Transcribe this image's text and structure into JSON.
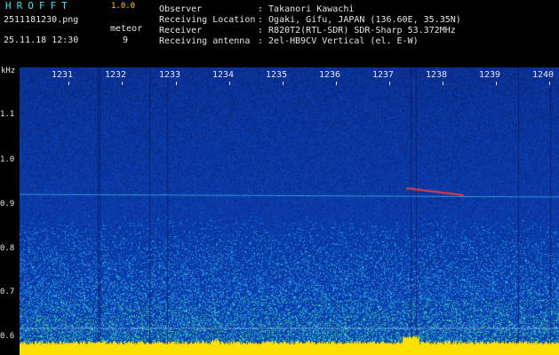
{
  "header": {
    "logo": "HROFFT",
    "version": "1.0.0",
    "filename": "2511181230.png",
    "meteor_label": "meteor",
    "meteor_count": "9",
    "datetime": "25.11.18 12:30",
    "observer_label": "Observer",
    "observer_value": ": Takanori Kawachi",
    "location_label": "Receiving Location",
    "location_value": ": Ogaki, Gifu, JAPAN (136.60E, 35.35N)",
    "receiver_label": "Receiver",
    "receiver_value": ": R820T2(RTL-SDR) SDR-Sharp 53.372MHz",
    "antenna_label": "Receiving antenna",
    "antenna_value": ": 2el-HB9CV Vertical (el. E-W)"
  },
  "axes": {
    "y_unit": "kHz",
    "y_ticks": [
      "1.1",
      "1.0",
      "0.9",
      "0.8",
      "0.7",
      "0.6"
    ],
    "x_ticks": [
      "1231",
      "1232",
      "1233",
      "1234",
      "1235",
      "1236",
      "1237",
      "1238",
      "1239",
      "1240"
    ]
  },
  "colors": {
    "background": "#000000",
    "noise": "#1a2fa8",
    "signal": "#ffe000",
    "text": "#e6e6e6",
    "accent": "#33e8e8"
  }
}
